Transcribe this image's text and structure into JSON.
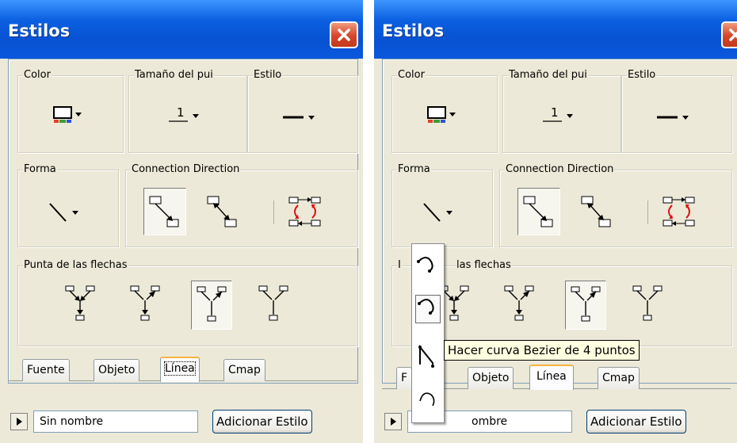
{
  "window_title": "Estilos",
  "groups": {
    "color": "Color",
    "tamano": "Tamaño del pui",
    "estilo": "Estilo",
    "forma": "Forma",
    "connection": "Connection Direction",
    "punta": "Punta de las flechas",
    "punta_partial": "las flechas",
    "partial_letter": "I"
  },
  "size_value": "1",
  "tabs": {
    "fuente": "Fuente",
    "objeto": "Objeto",
    "linea": "Línea",
    "cmap": "Cmap",
    "fuente_partial": "F"
  },
  "style_name": "Sin nombre",
  "style_name_partial": "ombre",
  "add_button": "Adicionar Estilo",
  "tooltip": "Hacer curva Bezier de 4 puntos",
  "colors": {
    "titlebar": "#0a5fe0",
    "panel": "#ece9d8",
    "tab_highlight": "#f8b33e",
    "tooltip_bg": "#ffffe1"
  },
  "icons": [
    "color-picker-icon",
    "dropdown-arrow-icon",
    "line-style-icon",
    "line-shape-icon",
    "connection-direction-icon",
    "arrowhead-icon",
    "curve-icon",
    "close-icon",
    "expand-arrow-icon"
  ]
}
